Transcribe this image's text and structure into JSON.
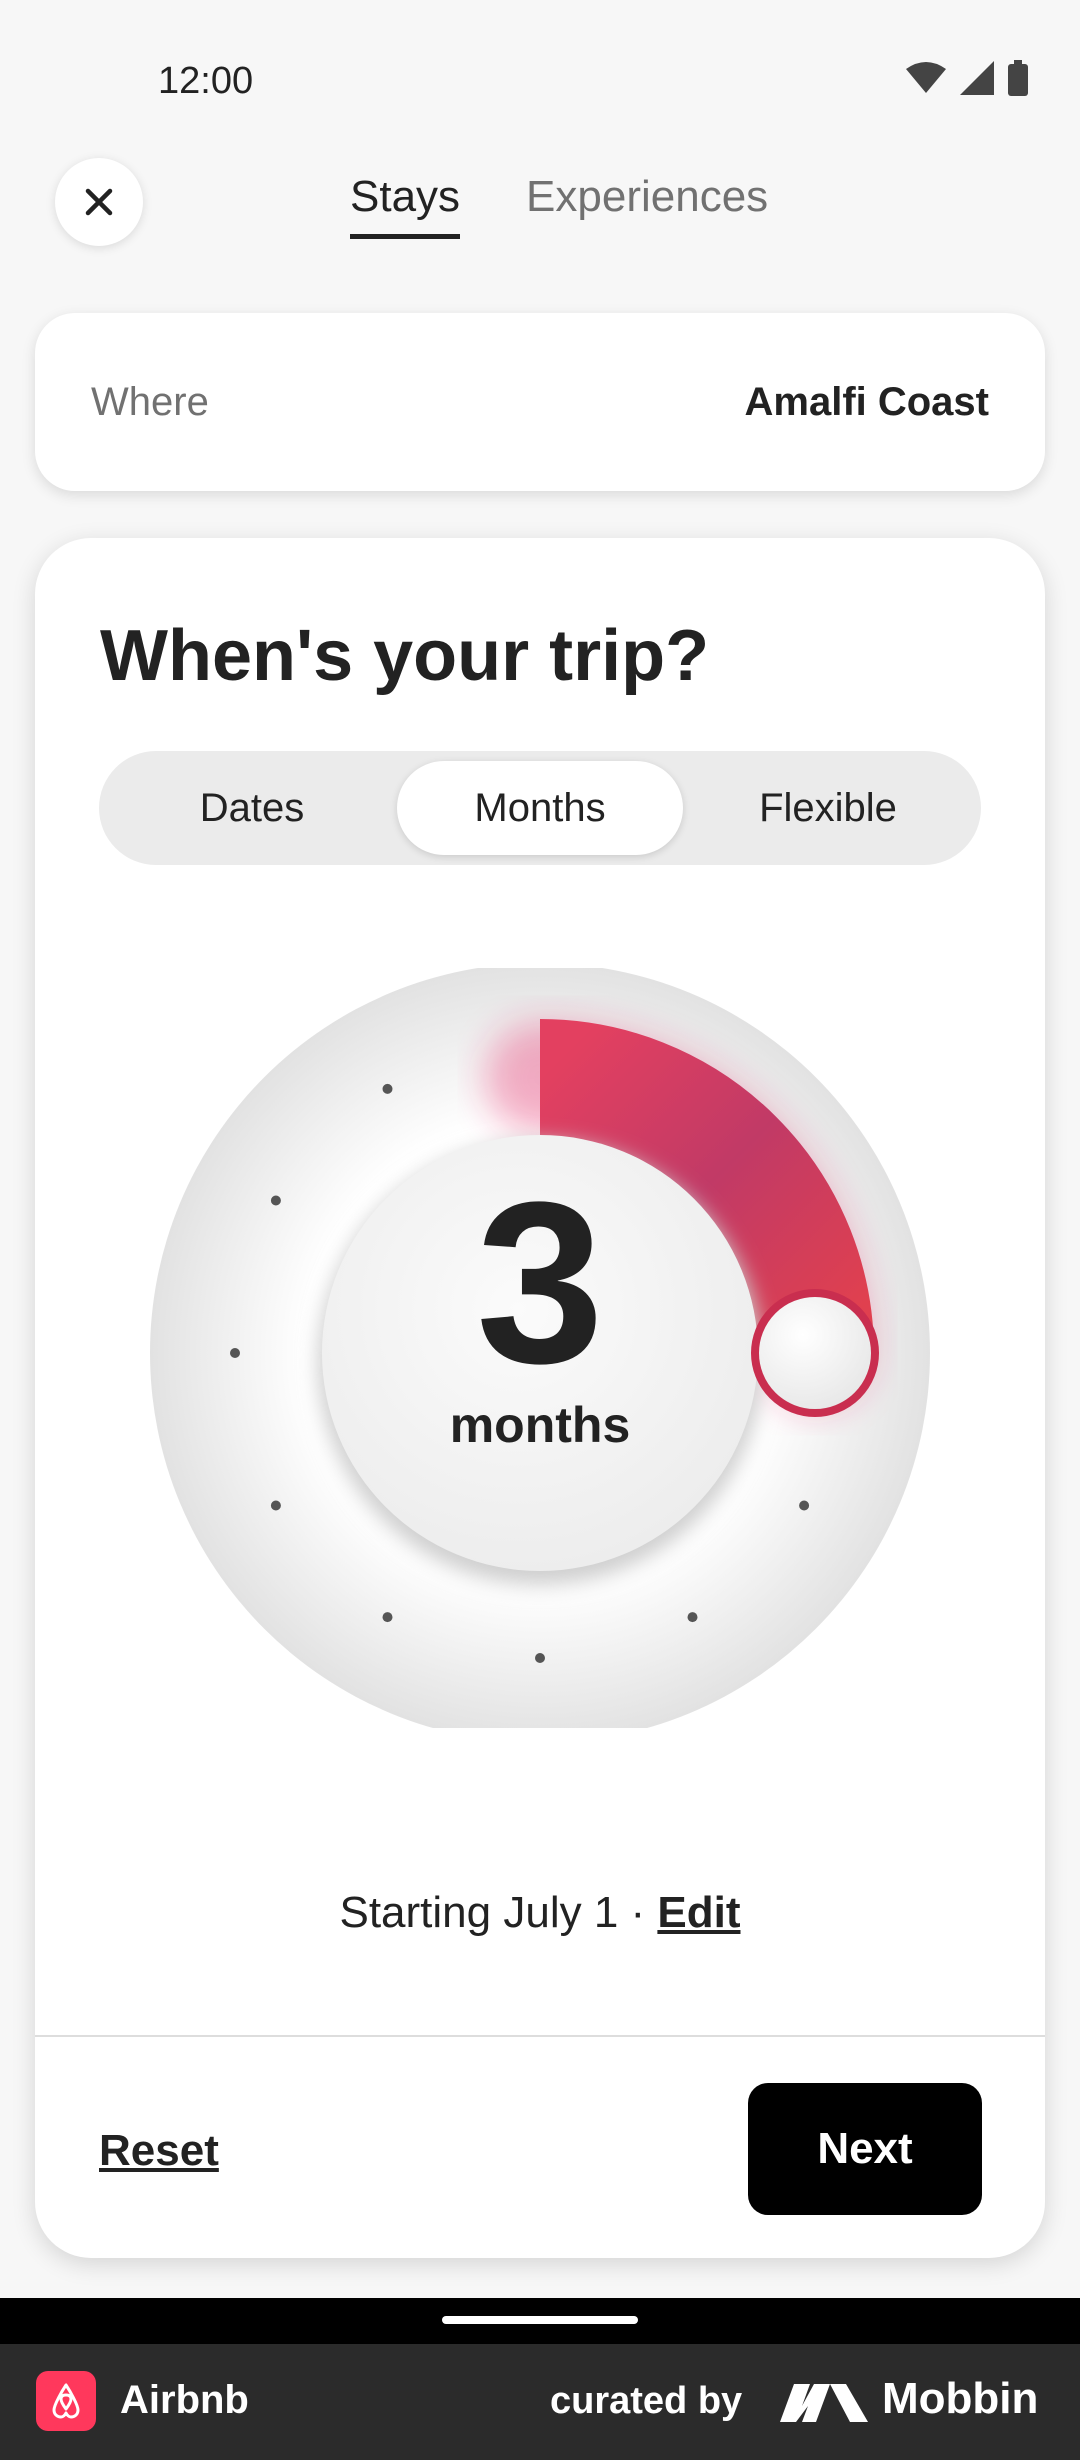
{
  "status": {
    "time": "12:00"
  },
  "tabs": [
    {
      "label": "Stays",
      "active": true
    },
    {
      "label": "Experiences",
      "active": false
    }
  ],
  "where": {
    "label": "Where",
    "value": "Amalfi Coast"
  },
  "trip": {
    "title": "When's your trip?",
    "options": [
      {
        "label": "Dates",
        "selected": false
      },
      {
        "label": "Months",
        "selected": true
      },
      {
        "label": "Flexible",
        "selected": false
      }
    ],
    "dial": {
      "value": "3",
      "unit": "months",
      "selected_months": 3,
      "total_months": 12,
      "accent": "#e31c5f"
    },
    "starting_text": "Starting July 1 · ",
    "edit_label": "Edit"
  },
  "actions": {
    "reset_label": "Reset",
    "next_label": "Next"
  },
  "footer": {
    "app_name": "Airbnb",
    "curated_by": "curated by",
    "curator": "Mobbin"
  }
}
